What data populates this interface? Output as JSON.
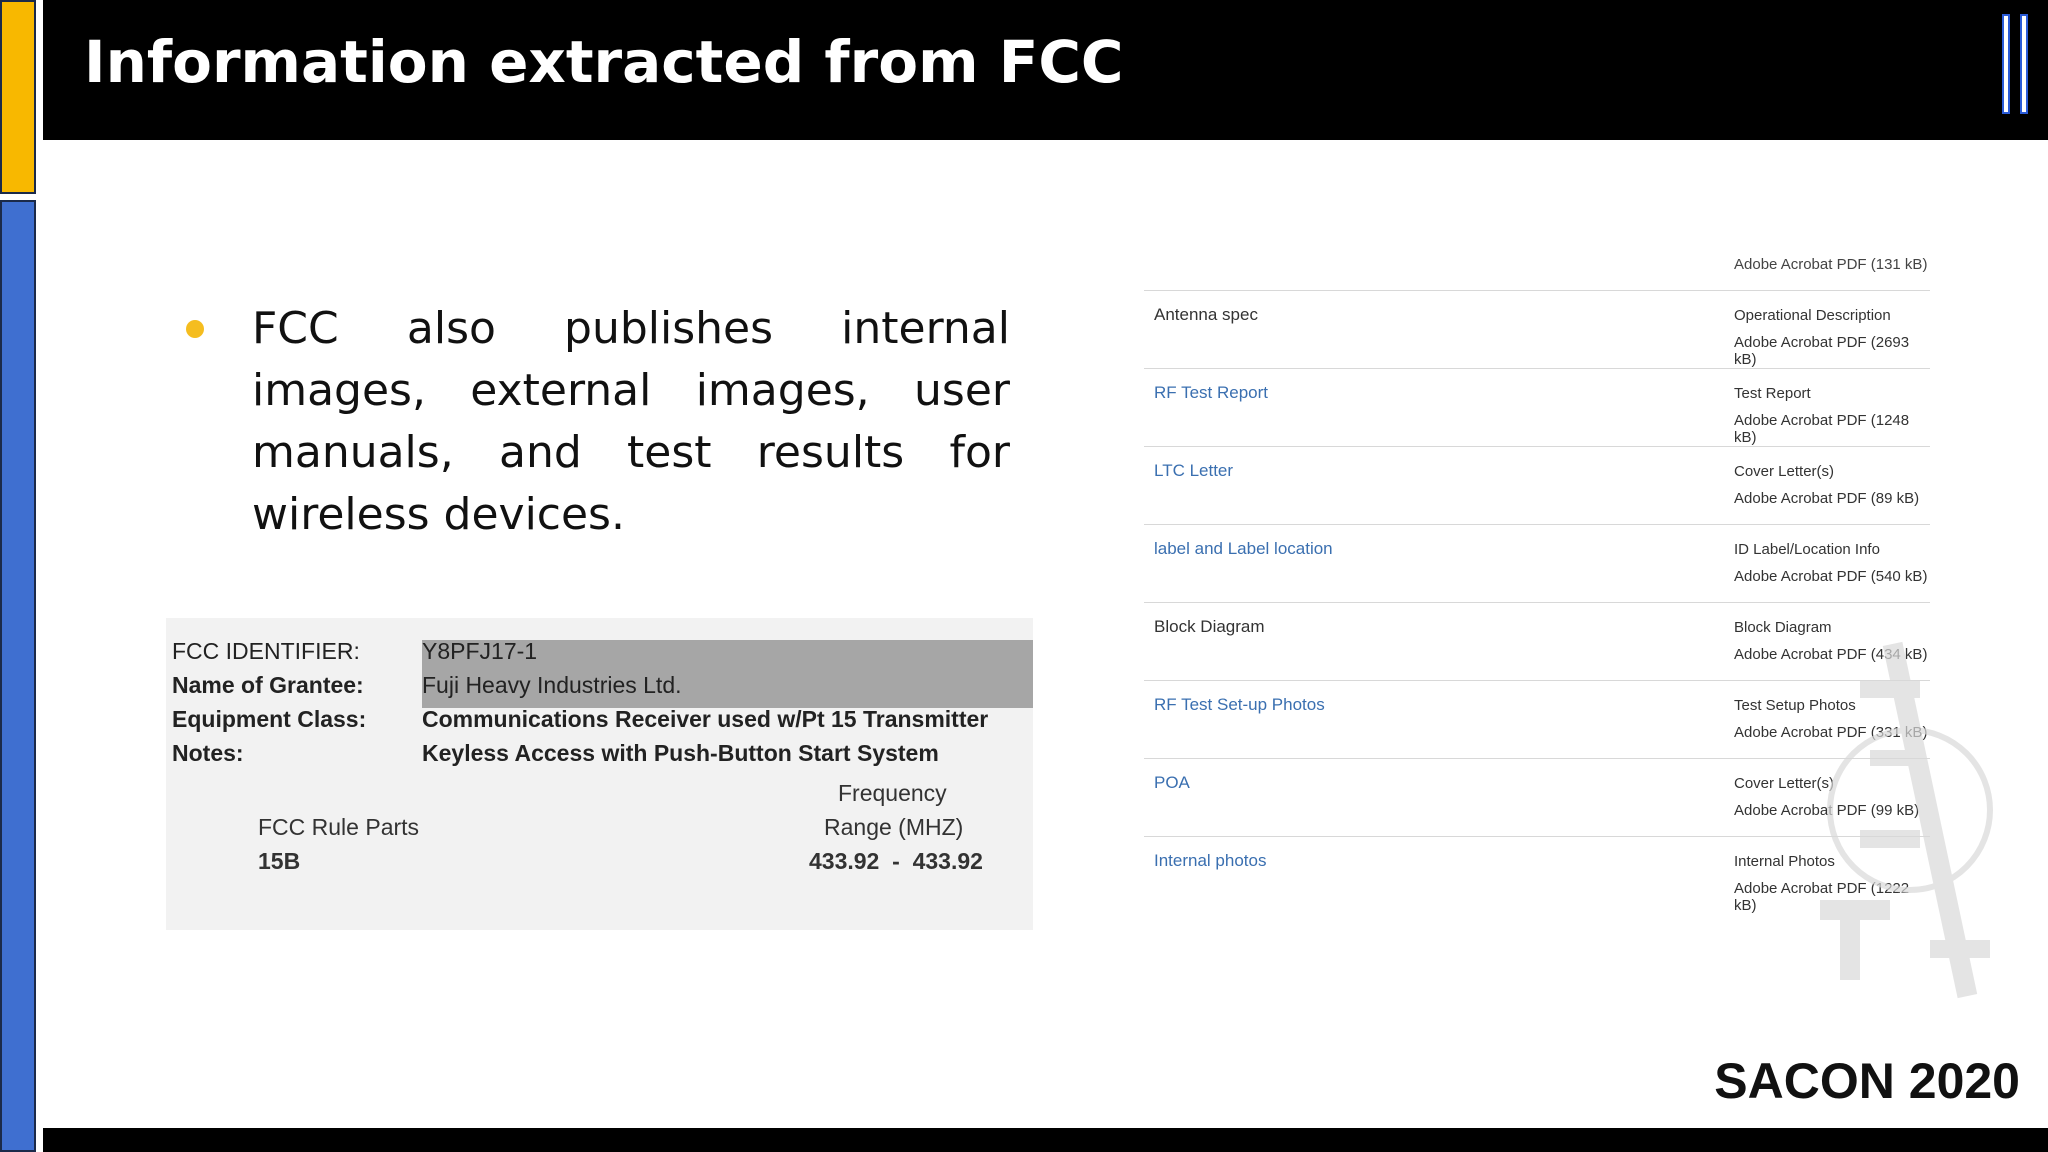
{
  "slide": {
    "title": "Information extracted from FCC",
    "bullet": "FCC also publishes internal images, external images, user manuals, and test results for wireless devices.",
    "footer_brand": "SACON 2020"
  },
  "fcc_record": {
    "fields": [
      {
        "label": "FCC IDENTIFIER:",
        "value": "Y8PFJ17-1",
        "bold": false
      },
      {
        "label": "Name of Grantee:",
        "value": "Fuji Heavy Industries Ltd.",
        "bold": false
      },
      {
        "label": "Equipment Class:",
        "value": "Communications Receiver used w/Pt 15 Transmitter",
        "bold": true
      },
      {
        "label": "Notes:",
        "value": "Keyless Access with Push-Button Start System",
        "bold": true
      }
    ],
    "rule_header": "FCC Rule Parts",
    "freq_header_1": "Frequency",
    "freq_header_2": "Range (MHZ)",
    "rule_value": "15B",
    "freq_value": "433.92  -  433.92"
  },
  "documents": {
    "top_file": "Adobe Acrobat PDF (131 kB)",
    "rows": [
      {
        "name": "Antenna spec",
        "link": false,
        "type": "Operational Description",
        "file": "Adobe Acrobat PDF (2693 kB)"
      },
      {
        "name": "RF Test Report",
        "link": true,
        "type": "Test Report",
        "file": "Adobe Acrobat PDF (1248 kB)"
      },
      {
        "name": "LTC Letter",
        "link": true,
        "type": "Cover Letter(s)",
        "file": "Adobe Acrobat PDF (89 kB)"
      },
      {
        "name": "label and Label location",
        "link": true,
        "type": "ID Label/Location Info",
        "file": "Adobe Acrobat PDF (540 kB)"
      },
      {
        "name": "Block Diagram",
        "link": false,
        "type": "Block Diagram",
        "file": "Adobe Acrobat PDF (434 kB)"
      },
      {
        "name": "RF Test Set-up Photos",
        "link": true,
        "type": "Test Setup Photos",
        "file": "Adobe Acrobat PDF (331 kB)"
      },
      {
        "name": "POA",
        "link": true,
        "type": "Cover Letter(s)",
        "file": "Adobe Acrobat PDF (99 kB)"
      },
      {
        "name": "Internal photos",
        "link": true,
        "type": "Internal Photos",
        "file": "Adobe Acrobat PDF (1222 kB)"
      }
    ]
  },
  "colors": {
    "accent_yellow": "#f8b800",
    "accent_blue": "#3f6fd0",
    "link": "#3a6fb0"
  }
}
